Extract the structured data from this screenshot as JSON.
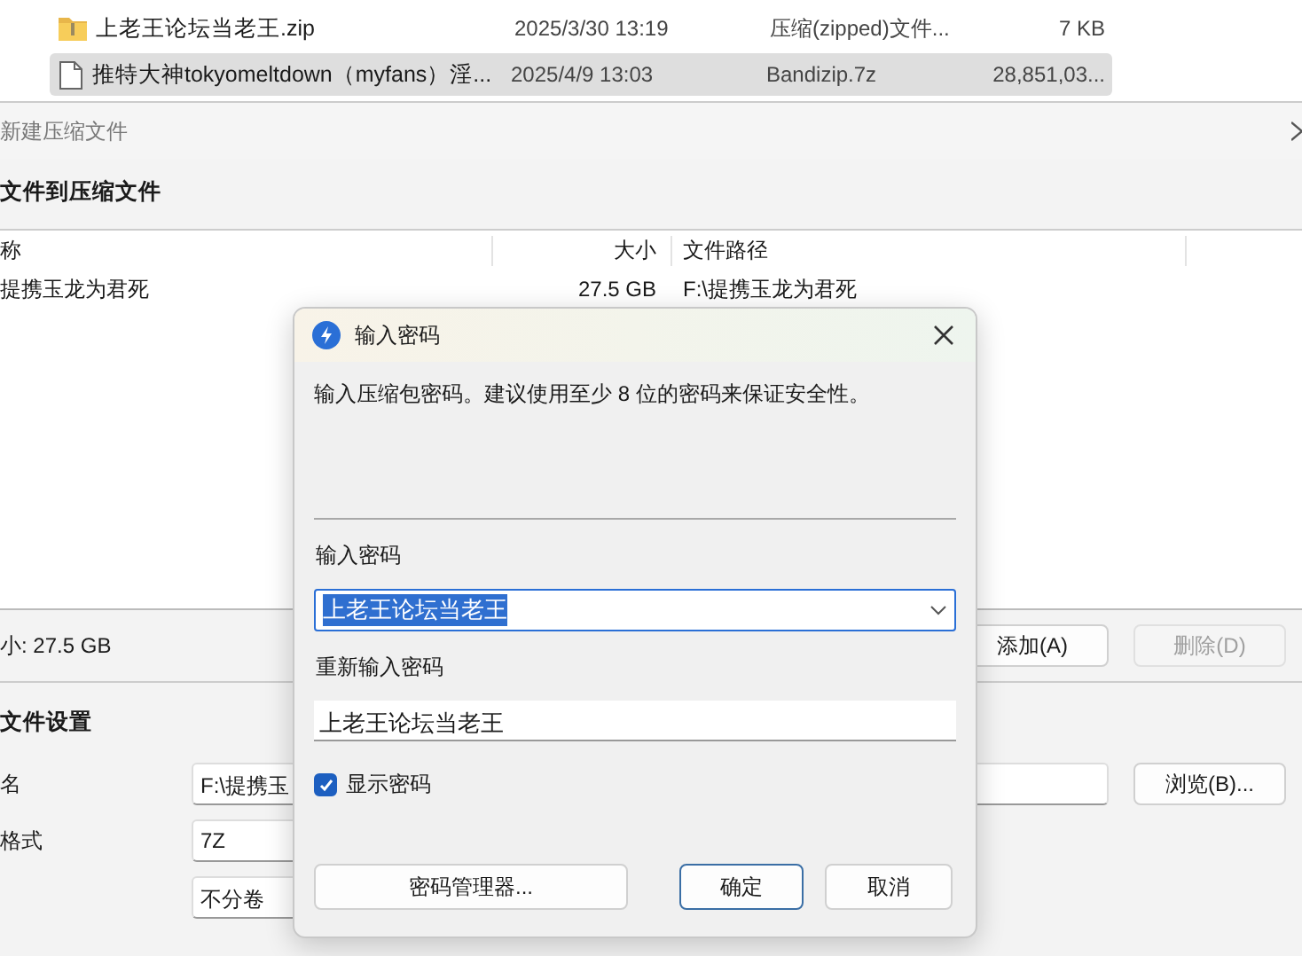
{
  "explorer": {
    "files": [
      {
        "kind": "zip",
        "name": "上老王论坛当老王.zip",
        "modified": "2025/3/30 13:19",
        "type": "压缩(zipped)文件...",
        "size": "7 KB",
        "selected": false
      },
      {
        "kind": "file",
        "name": "推特大神tokyomeltdown（myfans）淫...",
        "modified": "2025/4/9 13:03",
        "type": "Bandizip.7z",
        "size": "28,851,03...",
        "selected": true
      }
    ]
  },
  "archive_window": {
    "title": "新建压缩文件",
    "heading": "文件到压缩文件",
    "columns": [
      "称",
      "大小",
      "文件路径"
    ],
    "rows": [
      {
        "name": "提携玉龙为君死",
        "size": "27.5 GB",
        "path": "F:\\提携玉龙为君死"
      }
    ],
    "total": "小: 27.5 GB",
    "buttons": [
      {
        "label": "添加(A)",
        "disabled": false
      },
      {
        "label": "删除(D)",
        "disabled": true
      }
    ],
    "settings_heading": "文件设置",
    "settings": [
      {
        "label": "名",
        "value": "F:\\提携玉",
        "button": "浏览(B)..."
      },
      {
        "label": "格式",
        "value": "7Z"
      },
      {
        "value": "不分卷"
      }
    ]
  },
  "password_dialog": {
    "title": "输入密码",
    "message": "输入压缩包密码。建议使用至少 8 位的密码来保证安全性。",
    "password_label": "输入密码",
    "password": "上老王论坛当老王",
    "password_text_selected": true,
    "confirm_label": "重新输入密码",
    "confirm": "上老王论坛当老王",
    "show_password": {
      "label": "显示密码",
      "checked": true
    },
    "buttons": [
      {
        "label": "密码管理器...",
        "kind": "manager"
      },
      {
        "label": "确定",
        "kind": "default"
      },
      {
        "label": "取消",
        "kind": "cancel"
      }
    ]
  }
}
